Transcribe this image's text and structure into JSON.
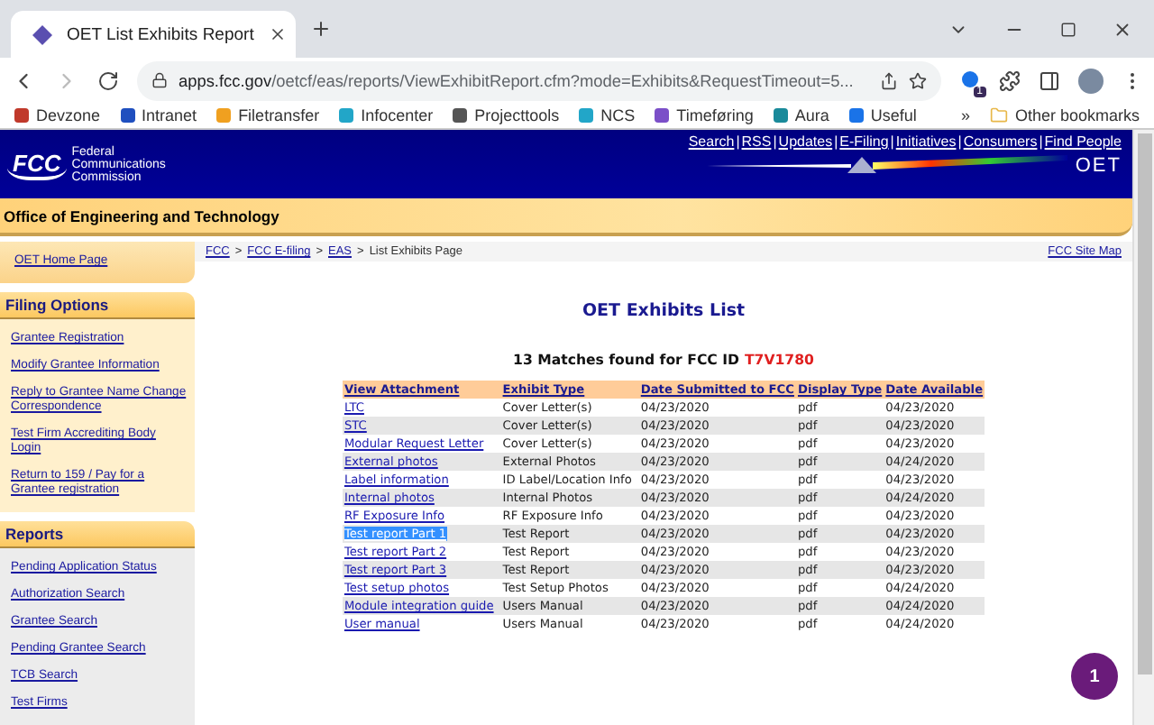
{
  "browser": {
    "tabs": [
      {
        "title": "OET List Exhibits Report",
        "selected": true
      }
    ],
    "url_host": "apps.fcc.gov",
    "url_path": "/oetcf/eas/reports/ViewExhibitReport.cfm?mode=Exhibits&RequestTimeout=5...",
    "extension_badge": "1",
    "bookmarks": [
      {
        "label": "Devzone",
        "color": "#c0392b"
      },
      {
        "label": "Intranet",
        "color": "#1f4fbf"
      },
      {
        "label": "Filetransfer",
        "color": "#f0a020"
      },
      {
        "label": "Infocenter",
        "color": "#22a6c8"
      },
      {
        "label": "Projecttools",
        "color": "#555555"
      },
      {
        "label": "NCS",
        "color": "#22a6c8"
      },
      {
        "label": "Timeføring",
        "color": "#7b4fc8"
      },
      {
        "label": "Aura",
        "color": "#1a8a9a"
      },
      {
        "label": "Useful",
        "color": "#1a73e8"
      }
    ],
    "overflow": "»",
    "other_bookmarks": "Other bookmarks"
  },
  "header": {
    "logo": "FCC",
    "agency": "Federal Communications Commission",
    "separator": "|",
    "nav": [
      "Search",
      "RSS",
      "Updates",
      "E-Filing",
      "Initiatives",
      "Consumers",
      "Find People"
    ],
    "office_logo": "OET"
  },
  "banner": {
    "title": "Office of Engineering and Technology"
  },
  "breadcrumb": {
    "links": [
      "FCC",
      "FCC E-filing",
      "EAS"
    ],
    "separator": ">",
    "current": "List Exhibits Page",
    "site_map": "FCC Site Map"
  },
  "sidebar": {
    "home_link": "OET Home Page",
    "sections": [
      {
        "title": "Filing Options",
        "kind": "filing",
        "items": [
          "Grantee Registration",
          "Modify Grantee Information",
          "Reply to Grantee Name Change Correspondence",
          "Test Firm Accrediting Body Login",
          "Return to 159 / Pay for a Grantee registration"
        ]
      },
      {
        "title": "Reports",
        "kind": "reports",
        "items": [
          "Pending Application Status",
          "Authorization Search",
          "Grantee Search",
          "Pending Grantee Search",
          "TCB Search",
          "Test Firms"
        ]
      }
    ]
  },
  "main": {
    "title": "OET Exhibits List",
    "matches": "13 Matches found for FCC ID",
    "fcc_id": "T7V1780",
    "table": {
      "columns": [
        "View Attachment",
        "Exhibit Type",
        "Date Submitted to FCC",
        "Display Type",
        "Date Available"
      ],
      "rows": [
        {
          "attachment": "LTC",
          "type": "Cover Letter(s)",
          "submitted": "04/23/2020",
          "display": "pdf",
          "available": "04/23/2020",
          "highlighted": false
        },
        {
          "attachment": "STC",
          "type": "Cover Letter(s)",
          "submitted": "04/23/2020",
          "display": "pdf",
          "available": "04/23/2020",
          "highlighted": false
        },
        {
          "attachment": "Modular Request Letter",
          "type": "Cover Letter(s)",
          "submitted": "04/23/2020",
          "display": "pdf",
          "available": "04/23/2020",
          "highlighted": false
        },
        {
          "attachment": "External photos",
          "type": "External Photos",
          "submitted": "04/23/2020",
          "display": "pdf",
          "available": "04/24/2020",
          "highlighted": false
        },
        {
          "attachment": "Label information",
          "type": "ID Label/Location Info",
          "submitted": "04/23/2020",
          "display": "pdf",
          "available": "04/23/2020",
          "highlighted": false
        },
        {
          "attachment": "Internal photos",
          "type": "Internal Photos",
          "submitted": "04/23/2020",
          "display": "pdf",
          "available": "04/24/2020",
          "highlighted": false
        },
        {
          "attachment": "RF Exposure Info",
          "type": "RF Exposure Info",
          "submitted": "04/23/2020",
          "display": "pdf",
          "available": "04/23/2020",
          "highlighted": false
        },
        {
          "attachment": "Test report Part 1",
          "type": "Test Report",
          "submitted": "04/23/2020",
          "display": "pdf",
          "available": "04/23/2020",
          "highlighted": true
        },
        {
          "attachment": "Test report Part 2",
          "type": "Test Report",
          "submitted": "04/23/2020",
          "display": "pdf",
          "available": "04/23/2020",
          "highlighted": false
        },
        {
          "attachment": "Test report Part 3",
          "type": "Test Report",
          "submitted": "04/23/2020",
          "display": "pdf",
          "available": "04/23/2020",
          "highlighted": false
        },
        {
          "attachment": "Test setup photos",
          "type": "Test Setup Photos",
          "submitted": "04/23/2020",
          "display": "pdf",
          "available": "04/24/2020",
          "highlighted": false
        },
        {
          "attachment": "Module integration guide",
          "type": "Users Manual",
          "submitted": "04/23/2020",
          "display": "pdf",
          "available": "04/24/2020",
          "highlighted": false
        },
        {
          "attachment": "User manual",
          "type": "Users Manual",
          "submitted": "04/23/2020",
          "display": "pdf",
          "available": "04/24/2020",
          "highlighted": false
        }
      ]
    }
  },
  "notification": {
    "count": "1"
  }
}
